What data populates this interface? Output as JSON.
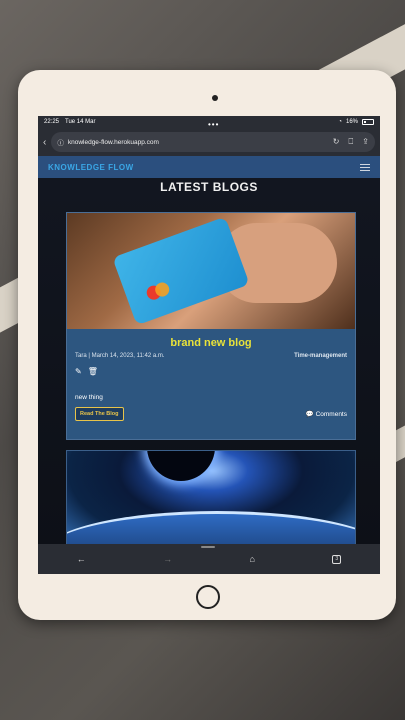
{
  "status": {
    "time": "22:25",
    "date": "Tue 14 Mar",
    "battery": "16%"
  },
  "browser": {
    "url": "knowledge-flow.herokuapp.com",
    "tab_count": "3"
  },
  "site": {
    "brand": "KNOWLEDGE FLOW"
  },
  "page": {
    "heading": "LATEST BLOGS"
  },
  "posts": [
    {
      "title": "brand new blog",
      "author_date": "Tara | March 14, 2023, 11:42 a.m.",
      "category": "Time-management",
      "excerpt": "new thing",
      "read_label": "Read The Blog",
      "comments_label": "Comments"
    }
  ],
  "icons": {
    "back": "chevron-left-icon",
    "info": "info-circle-icon",
    "reload": "reload-icon",
    "bookmark": "bookmark-icon",
    "share": "share-icon",
    "menu": "hamburger-icon",
    "edit": "edit-icon",
    "delete": "trash-icon",
    "comment": "comment-bubble-icon",
    "home": "home-icon",
    "forward": "arrow-right-icon"
  },
  "colors": {
    "nav": "#2b4f7e",
    "brand": "#3aa7e6",
    "title": "#e8e23a",
    "card": "#2d5680",
    "button_border": "#e8c44a"
  }
}
